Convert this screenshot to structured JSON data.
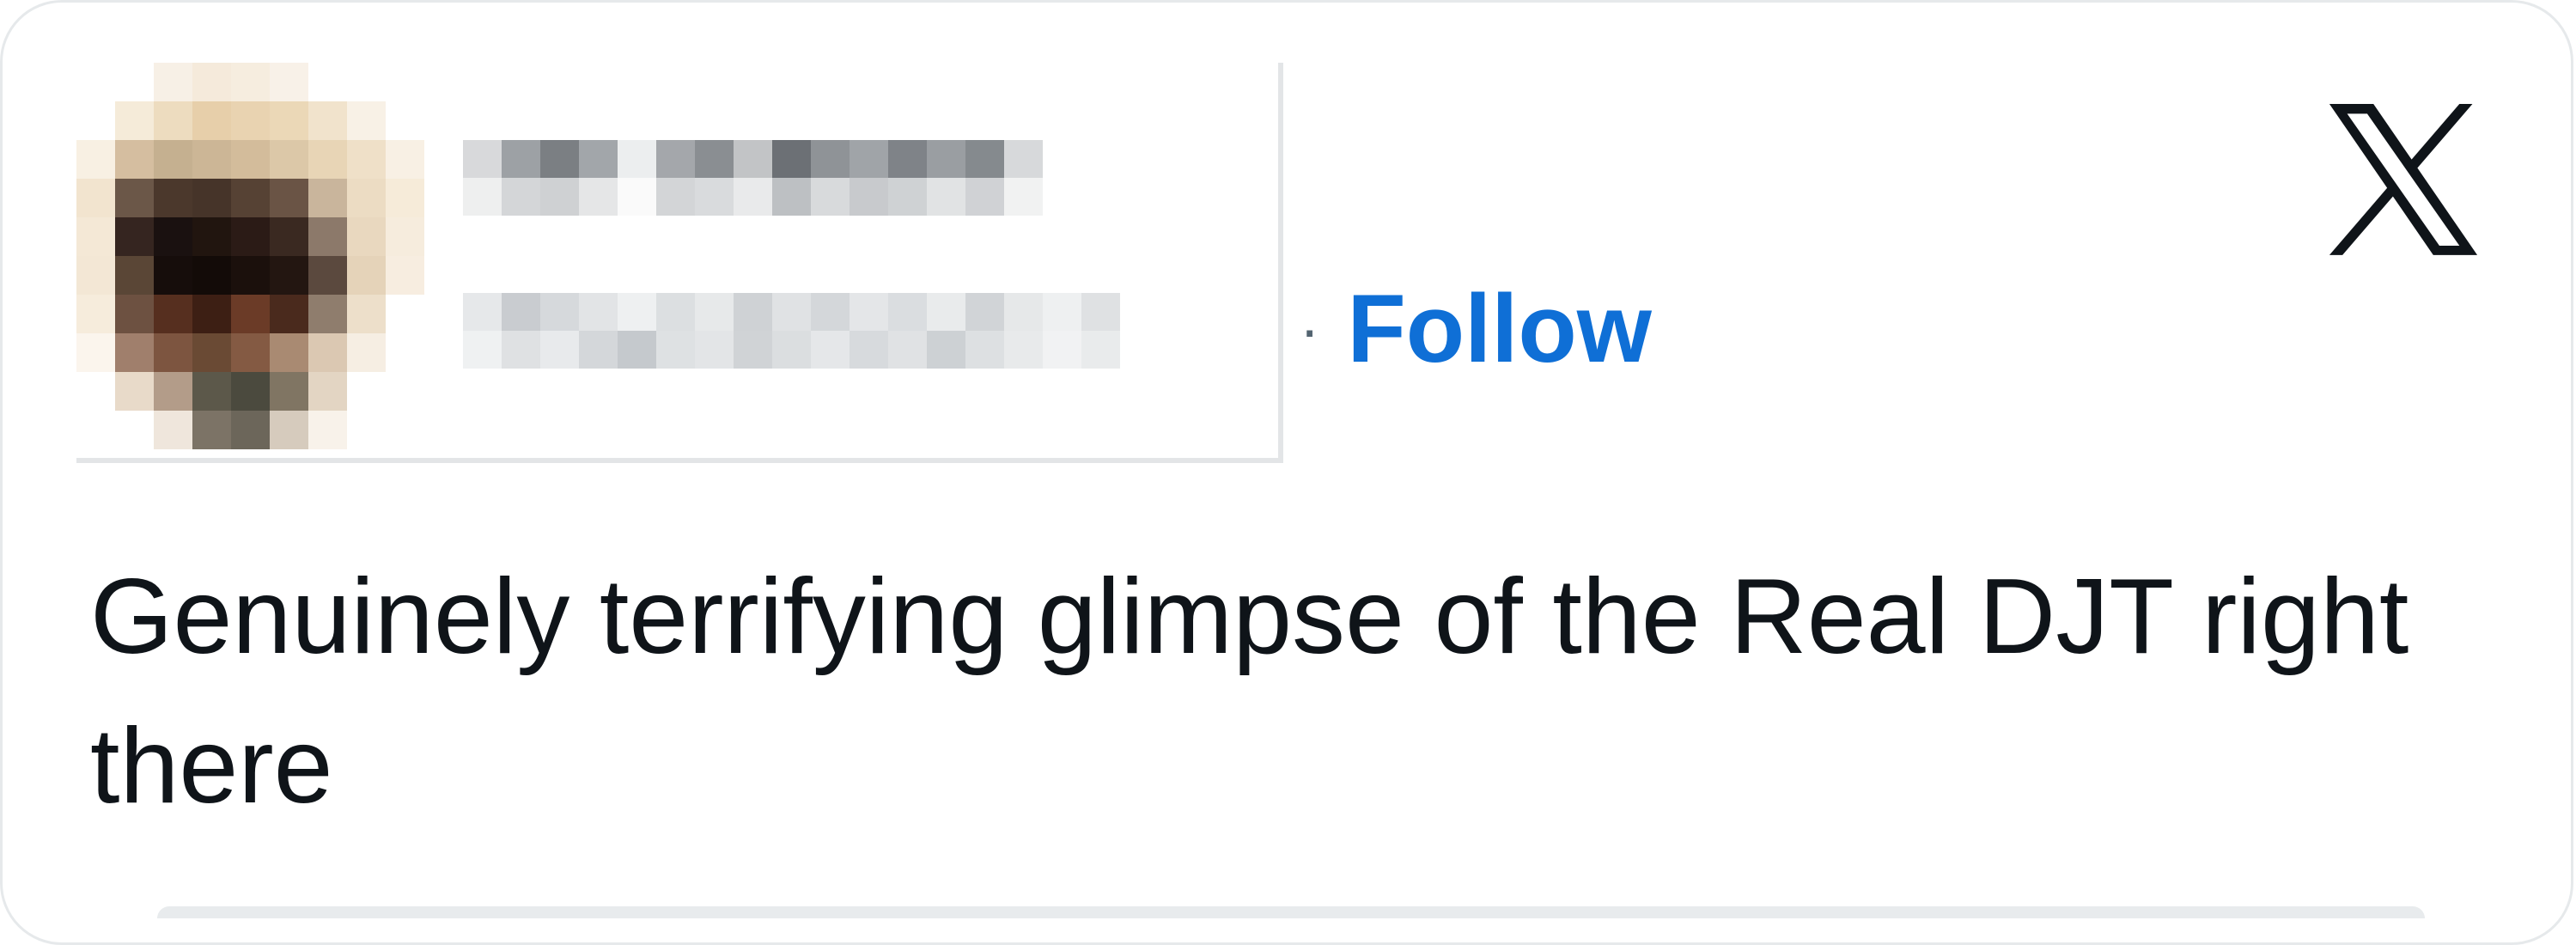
{
  "tweet": {
    "follow_separator": "·",
    "follow_label": "Follow",
    "text": "Genuinely terrifying glimpse of the Real DJT right there",
    "platform_icon": "x-logo-icon"
  },
  "colors": {
    "follow_blue": "#0f6fd6",
    "text_dark": "#0f1419",
    "card_border": "#e6e9eb"
  }
}
